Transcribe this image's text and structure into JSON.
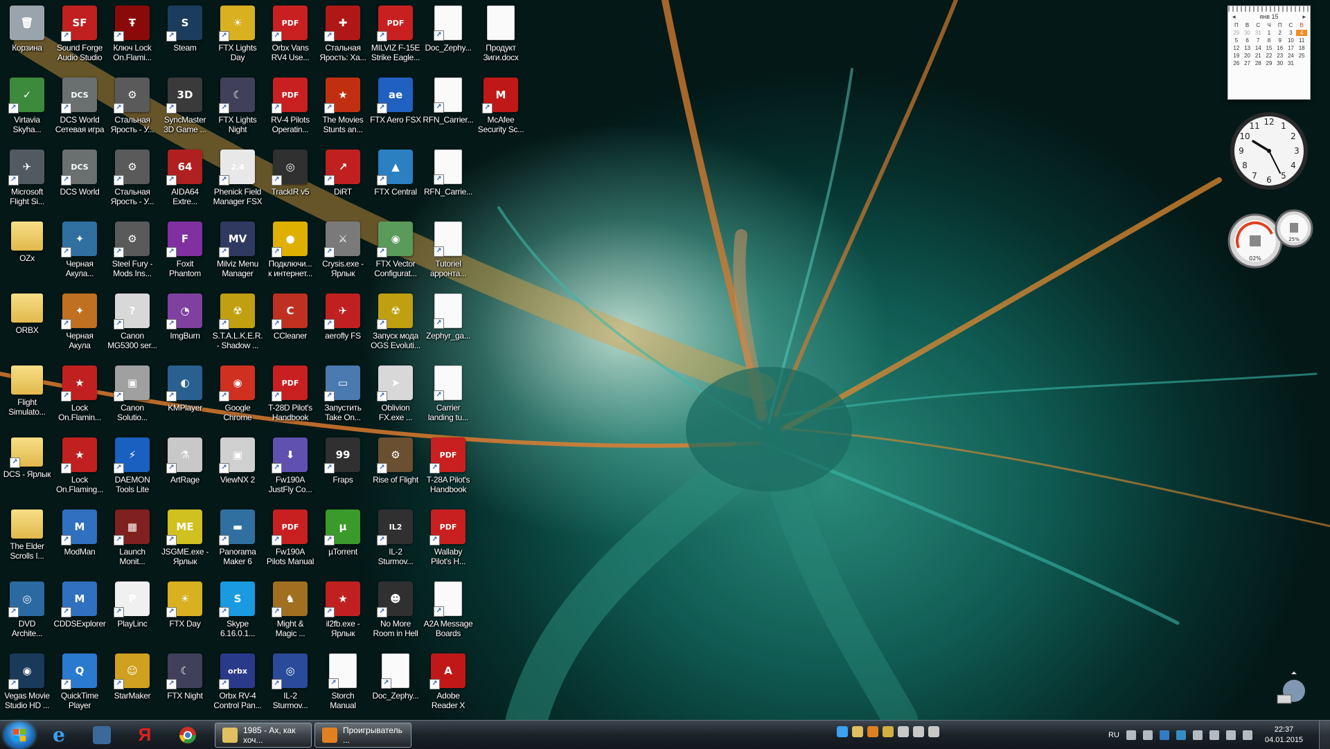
{
  "desktop": {
    "icons": [
      {
        "label": "Корзина",
        "glyph": "🗑",
        "color": "#9aa4ad",
        "shortcut": false
      },
      {
        "label": "Sound Forge\nAudio Studio",
        "glyph": "SF",
        "color": "#c02020",
        "shortcut": true
      },
      {
        "label": "Ключ Lock\nOn.Flami...",
        "glyph": "Ŧ",
        "color": "#8a0a0a",
        "shortcut": true
      },
      {
        "label": "Steam",
        "glyph": "S",
        "color": "#1b3c5c",
        "shortcut": true
      },
      {
        "label": "FTX Lights\nDay",
        "glyph": "☀",
        "color": "#d8b020",
        "shortcut": true
      },
      {
        "label": "Orbx Vans\nRV4 Use...",
        "glyph": "PDF",
        "color": "#c82020",
        "shortcut": true
      },
      {
        "label": "Стальная\nЯрость: Ха...",
        "glyph": "✚",
        "color": "#b01818",
        "shortcut": true
      },
      {
        "label": "MILVIZ F-15E\nStrike Eagle...",
        "glyph": "PDF",
        "color": "#c82020",
        "shortcut": true
      },
      {
        "label": "Doc_Zephy...",
        "glyph": "",
        "color": "doc",
        "shortcut": true
      },
      {
        "label": "Продукт\nЗиги.docx",
        "glyph": "",
        "color": "doc",
        "shortcut": false
      },
      {
        "label": "Virtavia\nSkyha...",
        "glyph": "✓",
        "color": "#3c8a3c",
        "shortcut": true
      },
      {
        "label": "DCS World\nСетевая игра",
        "glyph": "DCS",
        "color": "#6a7070",
        "shortcut": true
      },
      {
        "label": "Стальная\nЯрость - У...",
        "glyph": "⚙",
        "color": "#5a5a5a",
        "shortcut": true
      },
      {
        "label": "SyncMaster\n3D Game ...",
        "glyph": "3D",
        "color": "#3a3a3a",
        "shortcut": true
      },
      {
        "label": "FTX Lights\nNight",
        "glyph": "☾",
        "color": "#40405a",
        "shortcut": true
      },
      {
        "label": "RV-4 Pilots\nOperatin...",
        "glyph": "PDF",
        "color": "#c82020",
        "shortcut": true
      },
      {
        "label": "The Movies\nStunts an...",
        "glyph": "★",
        "color": "#c03010",
        "shortcut": true
      },
      {
        "label": "FTX Aero FSX",
        "glyph": "ae",
        "color": "#2060c0",
        "shortcut": true
      },
      {
        "label": "RFN_Carrier...",
        "glyph": "",
        "color": "doc",
        "shortcut": true
      },
      {
        "label": "McAfee\nSecurity Sc...",
        "glyph": "M",
        "color": "#c01818",
        "shortcut": true
      },
      {
        "label": "Microsoft\nFlight Si...",
        "glyph": "✈",
        "color": "#505a60",
        "shortcut": true
      },
      {
        "label": "DCS World",
        "glyph": "DCS",
        "color": "#6a7070",
        "shortcut": true
      },
      {
        "label": "Стальная\nЯрость - У...",
        "glyph": "⚙",
        "color": "#5a5a5a",
        "shortcut": true
      },
      {
        "label": "AIDA64\nExtre...",
        "glyph": "64",
        "color": "#b02020",
        "shortcut": true
      },
      {
        "label": "Phenick Field\nManager FSX",
        "glyph": "2.4",
        "color": "#e8e8e8",
        "shortcut": true
      },
      {
        "label": "TrackIR v5",
        "glyph": "◎",
        "color": "#303030",
        "shortcut": true
      },
      {
        "label": "DiRT",
        "glyph": "↗",
        "color": "#c02020",
        "shortcut": true
      },
      {
        "label": "FTX Central",
        "glyph": "▲",
        "color": "#2a80c0",
        "shortcut": true
      },
      {
        "label": "RFN_Carrie...",
        "glyph": "",
        "color": "doc",
        "shortcut": true
      },
      {
        "label": "OZx",
        "glyph": "",
        "color": "folder",
        "shortcut": false
      },
      {
        "label": "Черная\nАкула...",
        "glyph": "✦",
        "color": "#3070a0",
        "shortcut": true
      },
      {
        "label": "Steel Fury -\nMods Ins...",
        "glyph": "⚙",
        "color": "#5a5a5a",
        "shortcut": true
      },
      {
        "label": "Foxit\nPhantom",
        "glyph": "F",
        "color": "#8030a0",
        "shortcut": true
      },
      {
        "label": "Milviz Menu\nManager",
        "glyph": "MV",
        "color": "#303a60",
        "shortcut": true
      },
      {
        "label": "Подключи...\nк интернет...",
        "glyph": "●",
        "color": "#e0b000",
        "shortcut": true
      },
      {
        "label": "Crysis.exe -\nЯрлык",
        "glyph": "⚔",
        "color": "#7a7a7a",
        "shortcut": true
      },
      {
        "label": "FTX Vector\nConfigurat...",
        "glyph": "◉",
        "color": "#5a9a5a",
        "shortcut": true
      },
      {
        "label": "Tutoriel\nappонта...",
        "glyph": "",
        "color": "doc",
        "shortcut": true
      },
      {
        "label": "ORBX",
        "glyph": "",
        "color": "folder",
        "shortcut": false
      },
      {
        "label": "Черная\nАкула",
        "glyph": "✦",
        "color": "#c07020",
        "shortcut": true
      },
      {
        "label": "Canon\nMG5300 ser...",
        "glyph": "?",
        "color": "#d8d8d8",
        "shortcut": true
      },
      {
        "label": "ImgBurn",
        "glyph": "◔",
        "color": "#8040a0",
        "shortcut": true
      },
      {
        "label": "S.T.A.L.K.E.R.\n- Shadow ...",
        "glyph": "☢",
        "color": "#c0a010",
        "shortcut": true
      },
      {
        "label": "CCleaner",
        "glyph": "C",
        "color": "#c03020",
        "shortcut": true
      },
      {
        "label": "aerofly FS",
        "glyph": "✈",
        "color": "#c02020",
        "shortcut": true
      },
      {
        "label": "Запуск мода\nOGS Evoluti...",
        "glyph": "☢",
        "color": "#c0a010",
        "shortcut": true
      },
      {
        "label": "Zephyr_ga...",
        "glyph": "",
        "color": "doc",
        "shortcut": true
      },
      {
        "label": "Flight\nSimulato...",
        "glyph": "",
        "color": "folder",
        "shortcut": false
      },
      {
        "label": "Lock\nOn.Flamin...",
        "glyph": "★",
        "color": "#c02020",
        "shortcut": true
      },
      {
        "label": "Canon\nSolutio...",
        "glyph": "▣",
        "color": "#a0a0a0",
        "shortcut": true
      },
      {
        "label": "KMPlayer",
        "glyph": "◐",
        "color": "#2a6090",
        "shortcut": true
      },
      {
        "label": "Google\nChrome",
        "glyph": "◉",
        "color": "#d03020",
        "shortcut": true
      },
      {
        "label": "T-28D Pilot's\nHandbook",
        "glyph": "PDF",
        "color": "#c82020",
        "shortcut": true
      },
      {
        "label": "Запустить\nTake On...",
        "glyph": "▭",
        "color": "#4a7ab0",
        "shortcut": true
      },
      {
        "label": "Oblivion\nFX.exe ...",
        "glyph": "➤",
        "color": "#d8d8d8",
        "shortcut": true
      },
      {
        "label": "Carrier\nlanding tu...",
        "glyph": "",
        "color": "doc",
        "shortcut": true
      },
      {
        "label": "DCS - Ярлык",
        "glyph": "",
        "color": "folder",
        "shortcut": true
      },
      {
        "label": "Lock\nOn.Flaming...",
        "glyph": "★",
        "color": "#c02020",
        "shortcut": true
      },
      {
        "label": "DAEMON\nTools Lite",
        "glyph": "⚡",
        "color": "#1a60c0",
        "shortcut": true
      },
      {
        "label": "ArtRage",
        "glyph": "⚗",
        "color": "#c8c8c8",
        "shortcut": true
      },
      {
        "label": "ViewNX 2",
        "glyph": "▣",
        "color": "#d0d0d0",
        "shortcut": true
      },
      {
        "label": "Fw190A\nJustFly Co...",
        "glyph": "⬇",
        "color": "#6050b0",
        "shortcut": true
      },
      {
        "label": "Fraps",
        "glyph": "99",
        "color": "#303030",
        "shortcut": true
      },
      {
        "label": "Rise of Flight",
        "glyph": "⚙",
        "color": "#6a5030",
        "shortcut": true
      },
      {
        "label": "T-28A Pilot's\nHandbook",
        "glyph": "PDF",
        "color": "#c82020",
        "shortcut": true
      },
      {
        "label": "The Elder\nScrolls I...",
        "glyph": "",
        "color": "folder",
        "shortcut": false
      },
      {
        "label": "ModMan",
        "glyph": "M",
        "color": "#3070c0",
        "shortcut": true
      },
      {
        "label": "Launch\nMonit...",
        "glyph": "▦",
        "color": "#802020",
        "shortcut": true
      },
      {
        "label": "JSGME.exe -\nЯрлык",
        "glyph": "ME",
        "color": "#d0c020",
        "shortcut": true
      },
      {
        "label": "Panorama\nMaker 6",
        "glyph": "▬",
        "color": "#3070a0",
        "shortcut": true
      },
      {
        "label": "Fw190A\nPilots Manual",
        "glyph": "PDF",
        "color": "#c82020",
        "shortcut": true
      },
      {
        "label": "µTorrent",
        "glyph": "µ",
        "color": "#3a9a2a",
        "shortcut": true
      },
      {
        "label": "IL-2\nSturmov...",
        "glyph": "IL2",
        "color": "#303030",
        "shortcut": true
      },
      {
        "label": "Wallaby\nPilot's H...",
        "glyph": "PDF",
        "color": "#c82020",
        "shortcut": true
      },
      {
        "label": "DVD\nArchite...",
        "glyph": "◎",
        "color": "#2a6aa0",
        "shortcut": true
      },
      {
        "label": "CDDSExplorer",
        "glyph": "M",
        "color": "#3070c0",
        "shortcut": true
      },
      {
        "label": "PlayLinc",
        "glyph": "P",
        "color": "#f0f0f0",
        "shortcut": true
      },
      {
        "label": "FTX Day",
        "glyph": "☀",
        "color": "#d8b020",
        "shortcut": true
      },
      {
        "label": "Skype\n6.16.0.1...",
        "glyph": "S",
        "color": "#1a9ae0",
        "shortcut": true
      },
      {
        "label": "Might &\nMagic ...",
        "glyph": "♞",
        "color": "#a07020",
        "shortcut": true
      },
      {
        "label": "il2fb.exe -\nЯрлык",
        "glyph": "★",
        "color": "#c02020",
        "shortcut": true
      },
      {
        "label": "No More\nRoom in Hell",
        "glyph": "☻",
        "color": "#303030",
        "shortcut": true
      },
      {
        "label": "A2A Message\nBoards",
        "glyph": "",
        "color": "doc",
        "shortcut": true
      },
      {
        "label": "Vegas Movie\nStudio HD ...",
        "glyph": "◉",
        "color": "#1a3a5a",
        "shortcut": true
      },
      {
        "label": "QuickTime\nPlayer",
        "glyph": "Q",
        "color": "#2a7ad0",
        "shortcut": true
      },
      {
        "label": "StarMaker",
        "glyph": "☺",
        "color": "#d0a020",
        "shortcut": true
      },
      {
        "label": "FTX Night",
        "glyph": "☾",
        "color": "#40405a",
        "shortcut": true
      },
      {
        "label": "Orbx RV-4\nControl Pan...",
        "glyph": "orbx",
        "color": "#2a3a8a",
        "shortcut": true
      },
      {
        "label": "IL-2\nSturmov...",
        "glyph": "◎",
        "color": "#2a4a9a",
        "shortcut": true
      },
      {
        "label": "Storch\nManual",
        "glyph": "",
        "color": "doc",
        "shortcut": true
      },
      {
        "label": "Doc_Zephy...",
        "glyph": "",
        "color": "doc",
        "shortcut": true
      },
      {
        "label": "Adobe\nReader X",
        "glyph": "A",
        "color": "#c01818",
        "shortcut": true
      }
    ]
  },
  "calendar": {
    "month": "янв 15",
    "weekdays": [
      "П",
      "В",
      "С",
      "Ч",
      "П",
      "С",
      "В"
    ],
    "days": [
      [
        "29",
        "30",
        "31",
        "1",
        "2",
        "3",
        "4"
      ],
      [
        "5",
        "6",
        "7",
        "8",
        "9",
        "10",
        "11"
      ],
      [
        "12",
        "13",
        "14",
        "15",
        "16",
        "17",
        "18"
      ],
      [
        "19",
        "20",
        "21",
        "22",
        "23",
        "24",
        "25"
      ],
      [
        "26",
        "27",
        "28",
        "29",
        "30",
        "31",
        ""
      ]
    ],
    "today": "4"
  },
  "cpu_meter": {
    "cpu_percent": "02%",
    "mem_percent": "25%"
  },
  "taskbar": {
    "tasks": [
      {
        "label": "1985 - Ах, как хоч...",
        "color": "#e0c060"
      },
      {
        "label": "Проигрыватель ...",
        "color": "#e08020"
      }
    ],
    "language": "RU",
    "time": "22:37",
    "date": "04.01.2015"
  }
}
